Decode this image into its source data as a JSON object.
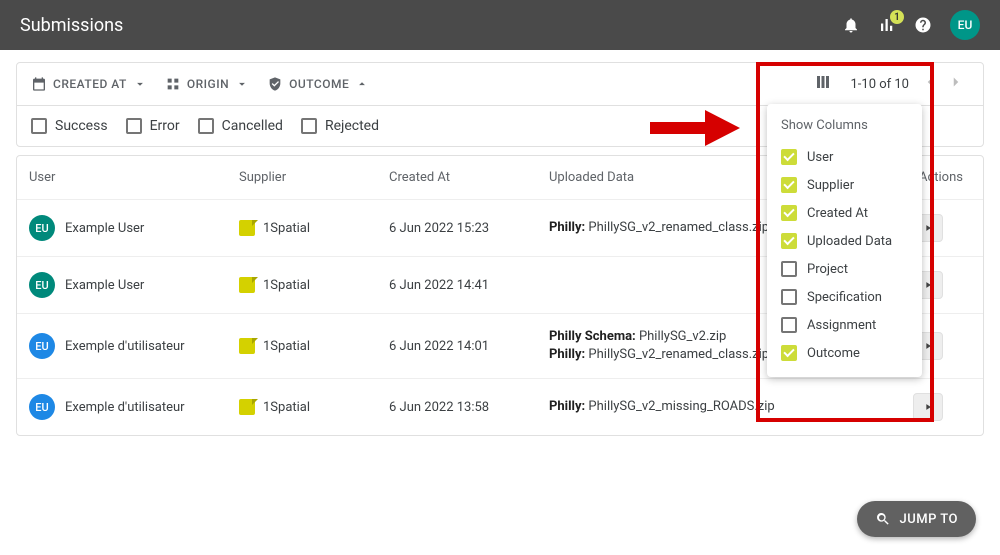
{
  "appbar": {
    "title": "Submissions",
    "stats_badge": "1",
    "avatar": "EU"
  },
  "filters": {
    "created_at": "CREATED AT",
    "origin": "ORIGIN",
    "outcome": "OUTCOME",
    "range": "1-10 of 10",
    "status": {
      "success": "Success",
      "error": "Error",
      "cancelled": "Cancelled",
      "rejected": "Rejected"
    }
  },
  "columns": {
    "user": "User",
    "supplier": "Supplier",
    "created": "Created At",
    "upload": "Uploaded Data",
    "actions": "Actions"
  },
  "rows": [
    {
      "avatarClass": "av-green",
      "initials": "EU",
      "user": "Example User",
      "supplier": "1Spatial",
      "created": "6 Jun 2022 15:23",
      "uploads": [
        {
          "label": "Philly:",
          "file": "PhillySG_v2_renamed_class.zip"
        }
      ]
    },
    {
      "avatarClass": "av-green",
      "initials": "EU",
      "user": "Example User",
      "supplier": "1Spatial",
      "created": "6 Jun 2022 14:41",
      "uploads": []
    },
    {
      "avatarClass": "av-blue",
      "initials": "EU",
      "user": "Exemple d'utilisateur",
      "supplier": "1Spatial",
      "created": "6 Jun 2022 14:01",
      "uploads": [
        {
          "label": "Philly Schema:",
          "file": "PhillySG_v2.zip"
        },
        {
          "label": "Philly:",
          "file": "PhillySG_v2_renamed_class.zip"
        }
      ]
    },
    {
      "avatarClass": "av-blue",
      "initials": "EU",
      "user": "Exemple d'utilisateur",
      "supplier": "1Spatial",
      "created": "6 Jun 2022 13:58",
      "uploads": [
        {
          "label": "Philly:",
          "file": "PhillySG_v2_missing_ROADS.zip"
        }
      ]
    }
  ],
  "popover": {
    "title": "Show Columns",
    "options": [
      {
        "label": "User",
        "checked": true
      },
      {
        "label": "Supplier",
        "checked": true
      },
      {
        "label": "Created At",
        "checked": true
      },
      {
        "label": "Uploaded Data",
        "checked": true
      },
      {
        "label": "Project",
        "checked": false
      },
      {
        "label": "Specification",
        "checked": false
      },
      {
        "label": "Assignment",
        "checked": false
      },
      {
        "label": "Outcome",
        "checked": true
      }
    ]
  },
  "jumpto": "JUMP TO"
}
